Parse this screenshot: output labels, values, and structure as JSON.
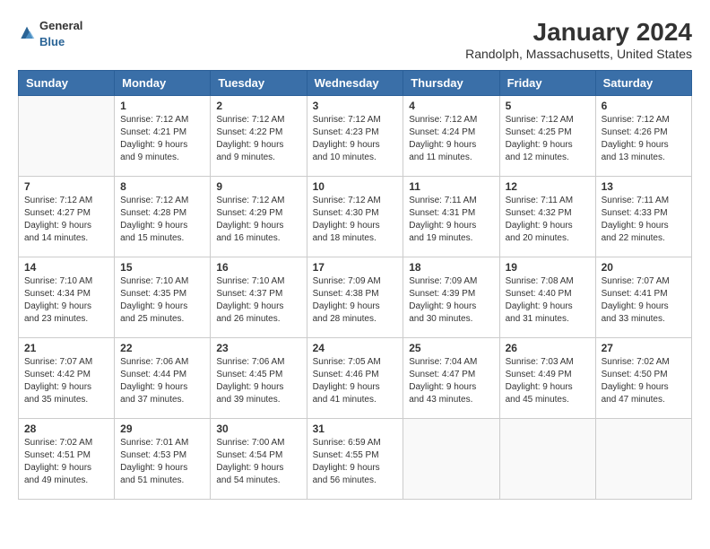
{
  "header": {
    "logo_general": "General",
    "logo_blue": "Blue",
    "month_year": "January 2024",
    "location": "Randolph, Massachusetts, United States"
  },
  "days_of_week": [
    "Sunday",
    "Monday",
    "Tuesday",
    "Wednesday",
    "Thursday",
    "Friday",
    "Saturday"
  ],
  "weeks": [
    [
      {
        "day": "",
        "info": ""
      },
      {
        "day": "1",
        "info": "Sunrise: 7:12 AM\nSunset: 4:21 PM\nDaylight: 9 hours\nand 9 minutes."
      },
      {
        "day": "2",
        "info": "Sunrise: 7:12 AM\nSunset: 4:22 PM\nDaylight: 9 hours\nand 9 minutes."
      },
      {
        "day": "3",
        "info": "Sunrise: 7:12 AM\nSunset: 4:23 PM\nDaylight: 9 hours\nand 10 minutes."
      },
      {
        "day": "4",
        "info": "Sunrise: 7:12 AM\nSunset: 4:24 PM\nDaylight: 9 hours\nand 11 minutes."
      },
      {
        "day": "5",
        "info": "Sunrise: 7:12 AM\nSunset: 4:25 PM\nDaylight: 9 hours\nand 12 minutes."
      },
      {
        "day": "6",
        "info": "Sunrise: 7:12 AM\nSunset: 4:26 PM\nDaylight: 9 hours\nand 13 minutes."
      }
    ],
    [
      {
        "day": "7",
        "info": "Sunrise: 7:12 AM\nSunset: 4:27 PM\nDaylight: 9 hours\nand 14 minutes."
      },
      {
        "day": "8",
        "info": "Sunrise: 7:12 AM\nSunset: 4:28 PM\nDaylight: 9 hours\nand 15 minutes."
      },
      {
        "day": "9",
        "info": "Sunrise: 7:12 AM\nSunset: 4:29 PM\nDaylight: 9 hours\nand 16 minutes."
      },
      {
        "day": "10",
        "info": "Sunrise: 7:12 AM\nSunset: 4:30 PM\nDaylight: 9 hours\nand 18 minutes."
      },
      {
        "day": "11",
        "info": "Sunrise: 7:11 AM\nSunset: 4:31 PM\nDaylight: 9 hours\nand 19 minutes."
      },
      {
        "day": "12",
        "info": "Sunrise: 7:11 AM\nSunset: 4:32 PM\nDaylight: 9 hours\nand 20 minutes."
      },
      {
        "day": "13",
        "info": "Sunrise: 7:11 AM\nSunset: 4:33 PM\nDaylight: 9 hours\nand 22 minutes."
      }
    ],
    [
      {
        "day": "14",
        "info": "Sunrise: 7:10 AM\nSunset: 4:34 PM\nDaylight: 9 hours\nand 23 minutes."
      },
      {
        "day": "15",
        "info": "Sunrise: 7:10 AM\nSunset: 4:35 PM\nDaylight: 9 hours\nand 25 minutes."
      },
      {
        "day": "16",
        "info": "Sunrise: 7:10 AM\nSunset: 4:37 PM\nDaylight: 9 hours\nand 26 minutes."
      },
      {
        "day": "17",
        "info": "Sunrise: 7:09 AM\nSunset: 4:38 PM\nDaylight: 9 hours\nand 28 minutes."
      },
      {
        "day": "18",
        "info": "Sunrise: 7:09 AM\nSunset: 4:39 PM\nDaylight: 9 hours\nand 30 minutes."
      },
      {
        "day": "19",
        "info": "Sunrise: 7:08 AM\nSunset: 4:40 PM\nDaylight: 9 hours\nand 31 minutes."
      },
      {
        "day": "20",
        "info": "Sunrise: 7:07 AM\nSunset: 4:41 PM\nDaylight: 9 hours\nand 33 minutes."
      }
    ],
    [
      {
        "day": "21",
        "info": "Sunrise: 7:07 AM\nSunset: 4:42 PM\nDaylight: 9 hours\nand 35 minutes."
      },
      {
        "day": "22",
        "info": "Sunrise: 7:06 AM\nSunset: 4:44 PM\nDaylight: 9 hours\nand 37 minutes."
      },
      {
        "day": "23",
        "info": "Sunrise: 7:06 AM\nSunset: 4:45 PM\nDaylight: 9 hours\nand 39 minutes."
      },
      {
        "day": "24",
        "info": "Sunrise: 7:05 AM\nSunset: 4:46 PM\nDaylight: 9 hours\nand 41 minutes."
      },
      {
        "day": "25",
        "info": "Sunrise: 7:04 AM\nSunset: 4:47 PM\nDaylight: 9 hours\nand 43 minutes."
      },
      {
        "day": "26",
        "info": "Sunrise: 7:03 AM\nSunset: 4:49 PM\nDaylight: 9 hours\nand 45 minutes."
      },
      {
        "day": "27",
        "info": "Sunrise: 7:02 AM\nSunset: 4:50 PM\nDaylight: 9 hours\nand 47 minutes."
      }
    ],
    [
      {
        "day": "28",
        "info": "Sunrise: 7:02 AM\nSunset: 4:51 PM\nDaylight: 9 hours\nand 49 minutes."
      },
      {
        "day": "29",
        "info": "Sunrise: 7:01 AM\nSunset: 4:53 PM\nDaylight: 9 hours\nand 51 minutes."
      },
      {
        "day": "30",
        "info": "Sunrise: 7:00 AM\nSunset: 4:54 PM\nDaylight: 9 hours\nand 54 minutes."
      },
      {
        "day": "31",
        "info": "Sunrise: 6:59 AM\nSunset: 4:55 PM\nDaylight: 9 hours\nand 56 minutes."
      },
      {
        "day": "",
        "info": ""
      },
      {
        "day": "",
        "info": ""
      },
      {
        "day": "",
        "info": ""
      }
    ]
  ]
}
